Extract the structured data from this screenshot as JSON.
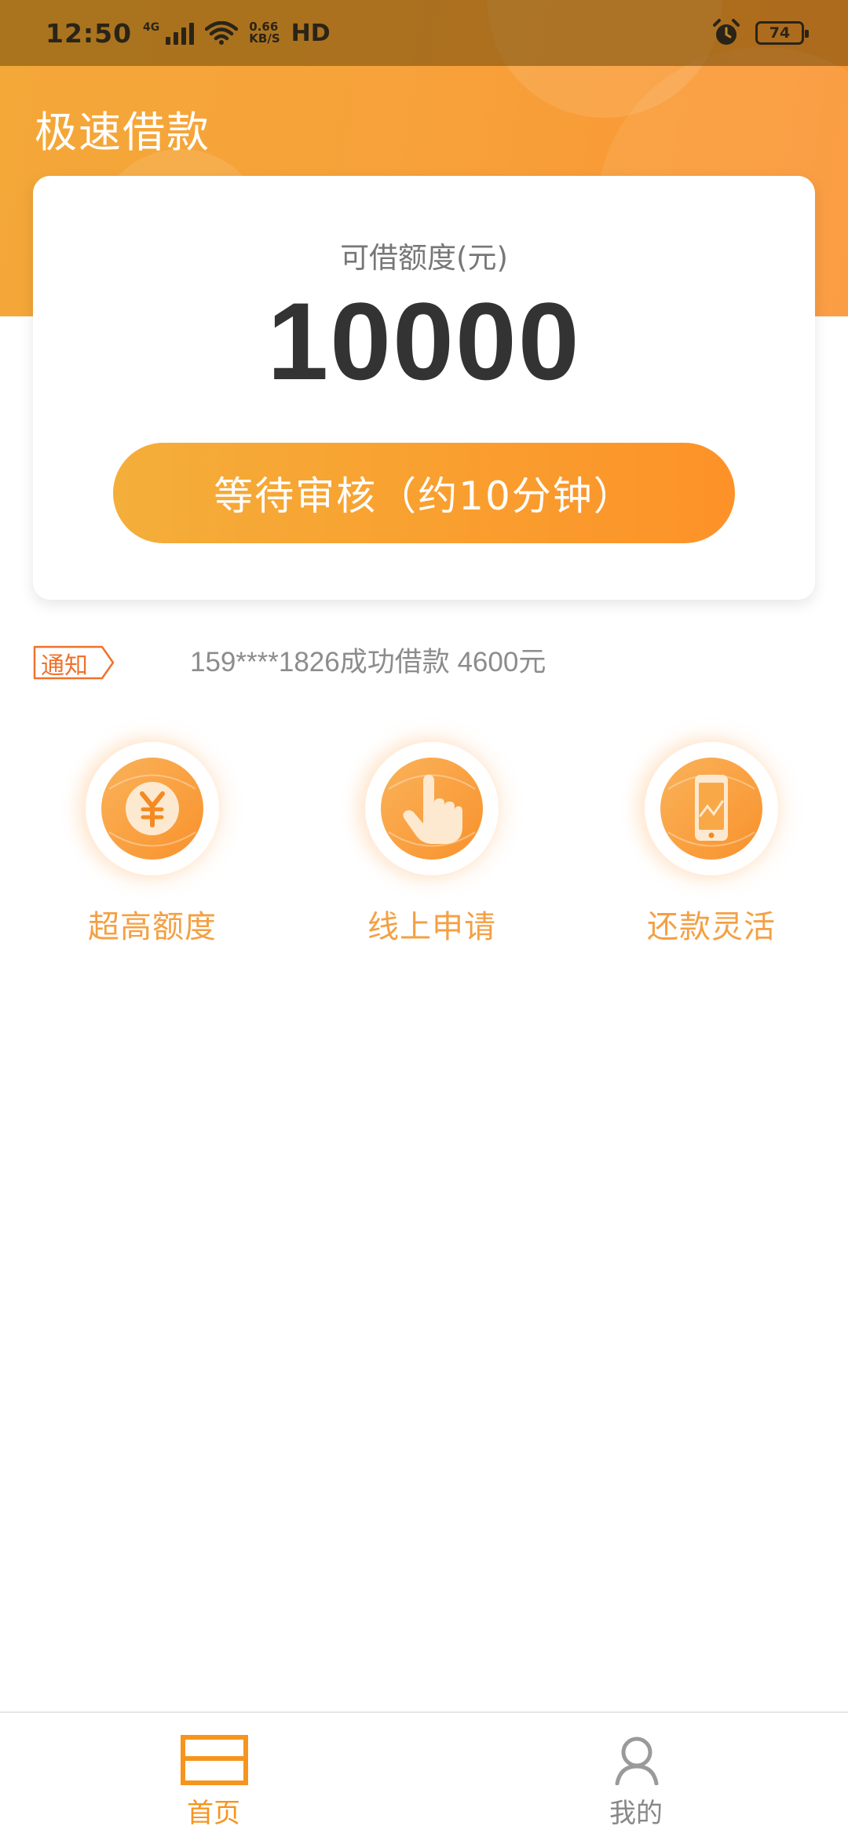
{
  "status_bar": {
    "time": "12:50",
    "network": "4G",
    "speed_value": "0.66",
    "speed_unit": "KB/S",
    "hd": "HD",
    "battery": "74"
  },
  "header": {
    "title": "极速借款"
  },
  "card": {
    "label": "可借额度(元)",
    "amount": "10000",
    "button_label": "等待审核（约10分钟）"
  },
  "notice": {
    "badge": "通知",
    "text": "159****1826成功借款 4600元"
  },
  "features": [
    {
      "label": "超高额度",
      "icon": "yuan-coin-icon"
    },
    {
      "label": "线上申请",
      "icon": "tap-hand-icon"
    },
    {
      "label": "还款灵活",
      "icon": "phone-chart-icon"
    }
  ],
  "bottom_nav": {
    "items": [
      {
        "label": "首页",
        "icon": "home-icon",
        "active": true
      },
      {
        "label": "我的",
        "icon": "person-icon",
        "active": false
      }
    ]
  },
  "colors": {
    "accent": "#f7941e",
    "header_gradient_start": "#f3a838",
    "header_gradient_end": "#fb9535",
    "amount_text": "#333333",
    "feature_label": "#f4a044"
  }
}
